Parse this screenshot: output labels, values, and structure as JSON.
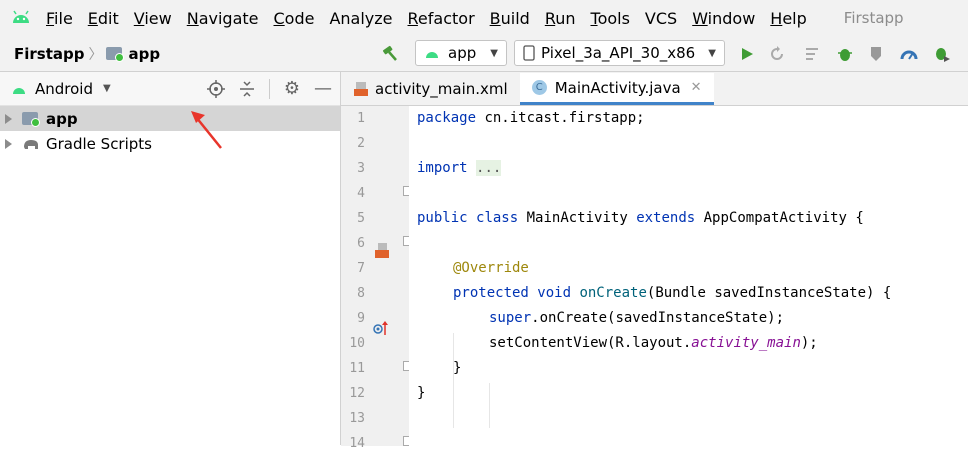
{
  "menu": {
    "items": [
      {
        "mn": "F",
        "rest": "ile"
      },
      {
        "mn": "E",
        "rest": "dit"
      },
      {
        "mn": "V",
        "rest": "iew"
      },
      {
        "mn": "N",
        "rest": "avigate"
      },
      {
        "mn": "C",
        "rest": "ode"
      },
      {
        "mn": "",
        "rest": "Analyze"
      },
      {
        "mn": "R",
        "rest": "efactor"
      },
      {
        "mn": "B",
        "rest": "uild"
      },
      {
        "mn": "R",
        "rest": "un"
      },
      {
        "mn": "T",
        "rest": "ools"
      },
      {
        "mn": "",
        "rest": "VCS"
      },
      {
        "mn": "W",
        "rest": "indow"
      },
      {
        "mn": "H",
        "rest": "elp"
      }
    ],
    "app_title": "Firstapp"
  },
  "toolbar": {
    "project": "Firstapp",
    "module": "app",
    "run_config": "app",
    "device": "Pixel_3a_API_30_x86"
  },
  "project_panel": {
    "view_mode": "Android",
    "tree": [
      {
        "label": "app",
        "selected": true
      },
      {
        "label": "Gradle Scripts",
        "selected": false
      }
    ]
  },
  "editor": {
    "tabs": [
      {
        "label": "activity_main.xml",
        "active": false
      },
      {
        "label": "MainActivity.java",
        "active": true
      }
    ],
    "line_numbers": [
      "1",
      "2",
      "3",
      "4",
      "5",
      "6",
      "7",
      "8",
      "9",
      "10",
      "11",
      "12",
      "13",
      "14"
    ],
    "code": {
      "l1_kw": "package",
      "l1_rest": " cn.itcast.firstapp;",
      "l3_kw": "import",
      "l3_rest": "...",
      "l5_kw1": "public",
      "l5_kw2": "class",
      "l5_name": " MainActivity ",
      "l5_kw3": "extends",
      "l5_rest": " AppCompatActivity {",
      "l7_ann": "@Override",
      "l8_kw1": "protected",
      "l8_kw2": "void",
      "l8_fn": "onCreate",
      "l8_rest": "(Bundle savedInstanceState) {",
      "l9_kw": "super",
      "l9_rest": ".onCreate(savedInstanceState);",
      "l10_pre": "setContentView(R.layout.",
      "l10_it": "activity_main",
      "l10_post": ");",
      "l11": "}",
      "l12": "}"
    }
  }
}
